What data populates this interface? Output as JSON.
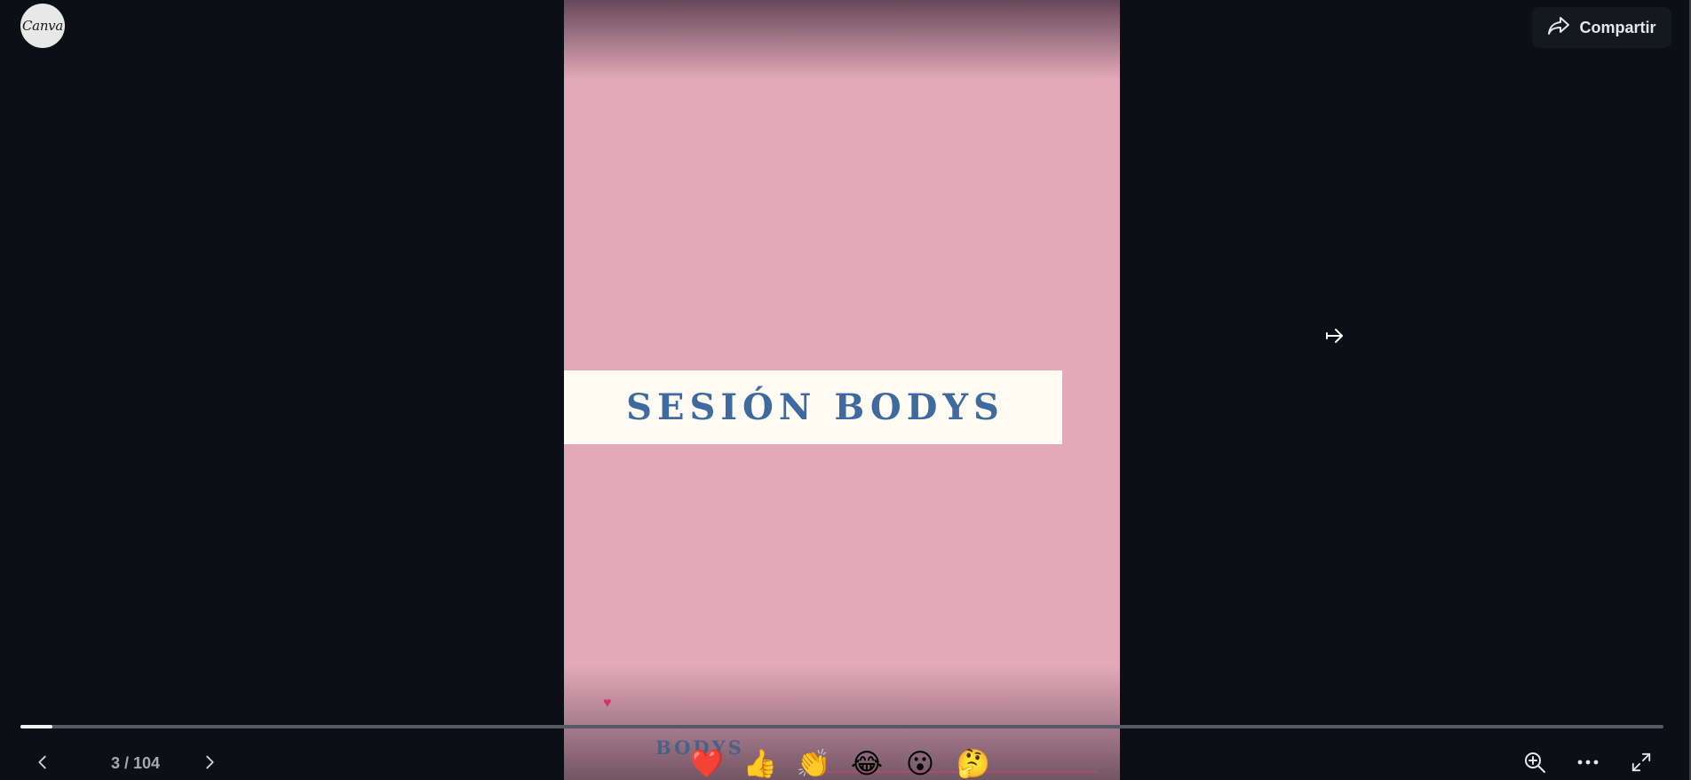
{
  "logo": {
    "text": "Canva"
  },
  "header": {
    "share_label": "Compartir"
  },
  "slide": {
    "title": "SESIÓN BODYS",
    "next_peek_text": "BODYS",
    "background_color": "#e3a9b9",
    "title_color": "#3e6aa0"
  },
  "pagination": {
    "label": "3 / 104",
    "current": 3,
    "total": 104
  },
  "progress": {
    "fraction": 0.0195
  },
  "reactions": [
    {
      "name": "heart",
      "glyph": "❤️"
    },
    {
      "name": "thumbs-up",
      "glyph": "👍"
    },
    {
      "name": "clapping-hands",
      "glyph": "👏"
    },
    {
      "name": "tears-of-joy",
      "glyph": "😂"
    },
    {
      "name": "surprised",
      "glyph": "😮"
    },
    {
      "name": "thinking",
      "glyph": "🤔"
    }
  ],
  "toolbar": {
    "icons": [
      "zoom-in-icon",
      "more-icon",
      "fullscreen-icon"
    ]
  },
  "icons": {
    "share": "share-arrow-icon",
    "prev": "chevron-left-icon",
    "next": "chevron-right-icon",
    "cursor": "cursor-arrow-icon"
  }
}
